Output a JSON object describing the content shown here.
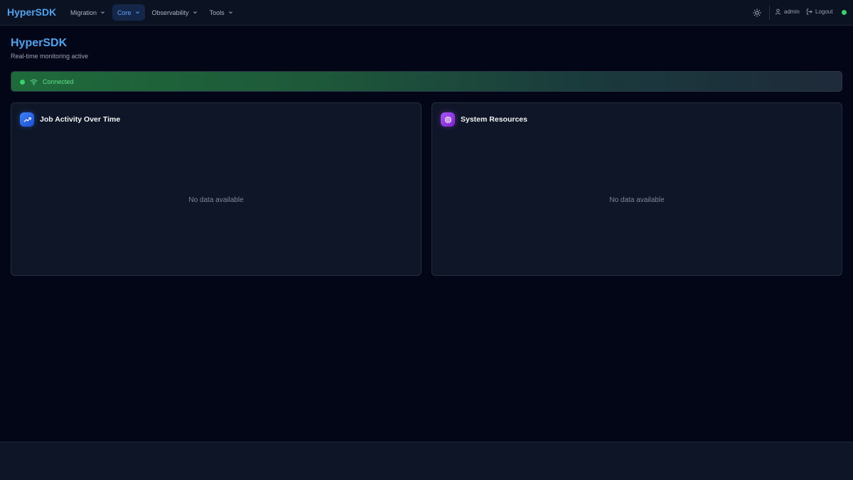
{
  "brand": "HyperSDK",
  "nav": {
    "items": [
      {
        "label": "Migration",
        "active": false
      },
      {
        "label": "Core",
        "active": true
      },
      {
        "label": "Observability",
        "active": false
      },
      {
        "label": "Tools",
        "active": false
      }
    ]
  },
  "header": {
    "user_label": "admin",
    "logout_label": "Logout",
    "status_color": "#34d36b"
  },
  "page": {
    "title": "HyperSDK",
    "subtitle": "Real-time monitoring active"
  },
  "connection": {
    "label": "Connected",
    "color": "#34d36b"
  },
  "cards": [
    {
      "title": "Job Activity Over Time",
      "empty_text": "No data available",
      "icon": "trending-up-icon",
      "accent": "#3b82f6"
    },
    {
      "title": "System Resources",
      "empty_text": "No data available",
      "icon": "cpu-icon",
      "accent": "#a855f7"
    }
  ]
}
